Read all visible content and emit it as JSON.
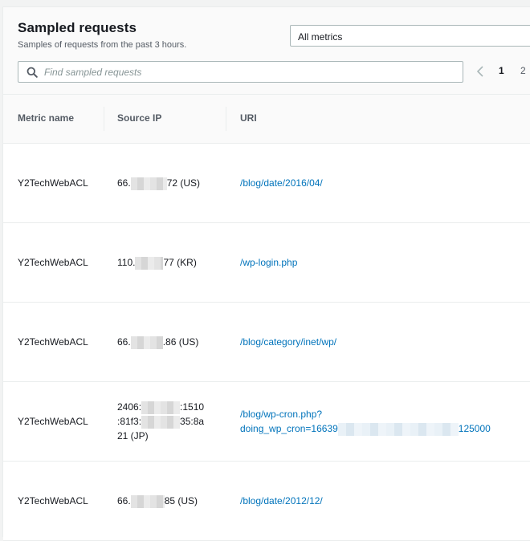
{
  "header": {
    "title": "Sampled requests",
    "subtitle": "Samples of requests from the past 3 hours.",
    "metric_filter": "All metrics"
  },
  "search": {
    "placeholder": "Find sampled requests"
  },
  "pagination": {
    "current_page": "1",
    "next_page": "2"
  },
  "table": {
    "columns": [
      "Metric name",
      "Source IP",
      "URI"
    ],
    "rows": [
      {
        "metric": "Y2TechWebACL",
        "ip_start": "66.",
        "ip_end": "72 (US)",
        "uri": "/blog/date/2016/04/"
      },
      {
        "metric": "Y2TechWebACL",
        "ip_start": "110.",
        "ip_end": "77 (KR)",
        "uri": "/wp-login.php"
      },
      {
        "metric": "Y2TechWebACL",
        "ip_start": "66.",
        "ip_end": ".86 (US)",
        "uri": "/blog/category/inet/wp/"
      },
      {
        "metric": "Y2TechWebACL",
        "ip_line1_start": "2406:",
        "ip_line1_end": ":1510",
        "ip_line2_start": ":81f3:",
        "ip_line2_end": "35:8a",
        "ip_line3": "21 (JP)",
        "uri_line1": "/blog/wp-cron.php?",
        "uri_line2_start": "doing_wp_cron=16639",
        "uri_line2_end": "125000"
      },
      {
        "metric": "Y2TechWebACL",
        "ip_start": "66.",
        "ip_end": "85 (US)",
        "uri": "/blog/date/2012/12/"
      }
    ]
  }
}
